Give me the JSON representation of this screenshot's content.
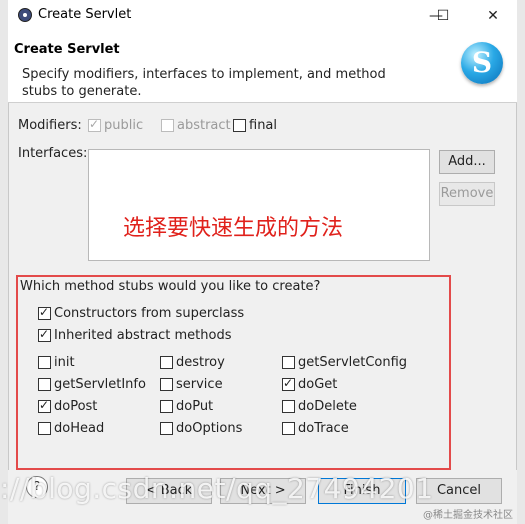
{
  "window": {
    "title": "Create Servlet",
    "minimize": "—",
    "maximize": "☐",
    "close": "✕"
  },
  "banner": {
    "heading": "Create Servlet",
    "description": "Specify modifiers, interfaces to implement, and method stubs to generate.",
    "logo_letter": "S"
  },
  "modifiers": {
    "label": "Modifiers:",
    "public": {
      "label": "public",
      "checked": true,
      "enabled": false
    },
    "abstract": {
      "label": "abstract",
      "checked": false,
      "enabled": false
    },
    "final": {
      "label": "final",
      "checked": false,
      "enabled": true
    }
  },
  "interfaces": {
    "label": "Interfaces:",
    "annotation": "选择要快速生成的方法",
    "add_button": "Add...",
    "remove_button": "Remove"
  },
  "stubs": {
    "question": "Which method stubs would you like to create?",
    "constructors": {
      "label": "Constructors from superclass",
      "checked": true
    },
    "inherited": {
      "label": "Inherited abstract methods",
      "checked": true
    },
    "methods": [
      {
        "label": "init",
        "checked": false
      },
      {
        "label": "destroy",
        "checked": false
      },
      {
        "label": "getServletConfig",
        "checked": false
      },
      {
        "label": "getServletInfo",
        "checked": false
      },
      {
        "label": "service",
        "checked": false
      },
      {
        "label": "doGet",
        "checked": true
      },
      {
        "label": "doPost",
        "checked": true
      },
      {
        "label": "doPut",
        "checked": false
      },
      {
        "label": "doDelete",
        "checked": false
      },
      {
        "label": "doHead",
        "checked": false
      },
      {
        "label": "doOptions",
        "checked": false
      },
      {
        "label": "doTrace",
        "checked": false
      }
    ]
  },
  "footer": {
    "help": "?",
    "back": "< Back",
    "next": "Next >",
    "finish": "Finish",
    "cancel": "Cancel"
  },
  "watermark": "://blog.csdn.net/qq_27494201",
  "watermark_small": "@稀土掘金技术社区"
}
